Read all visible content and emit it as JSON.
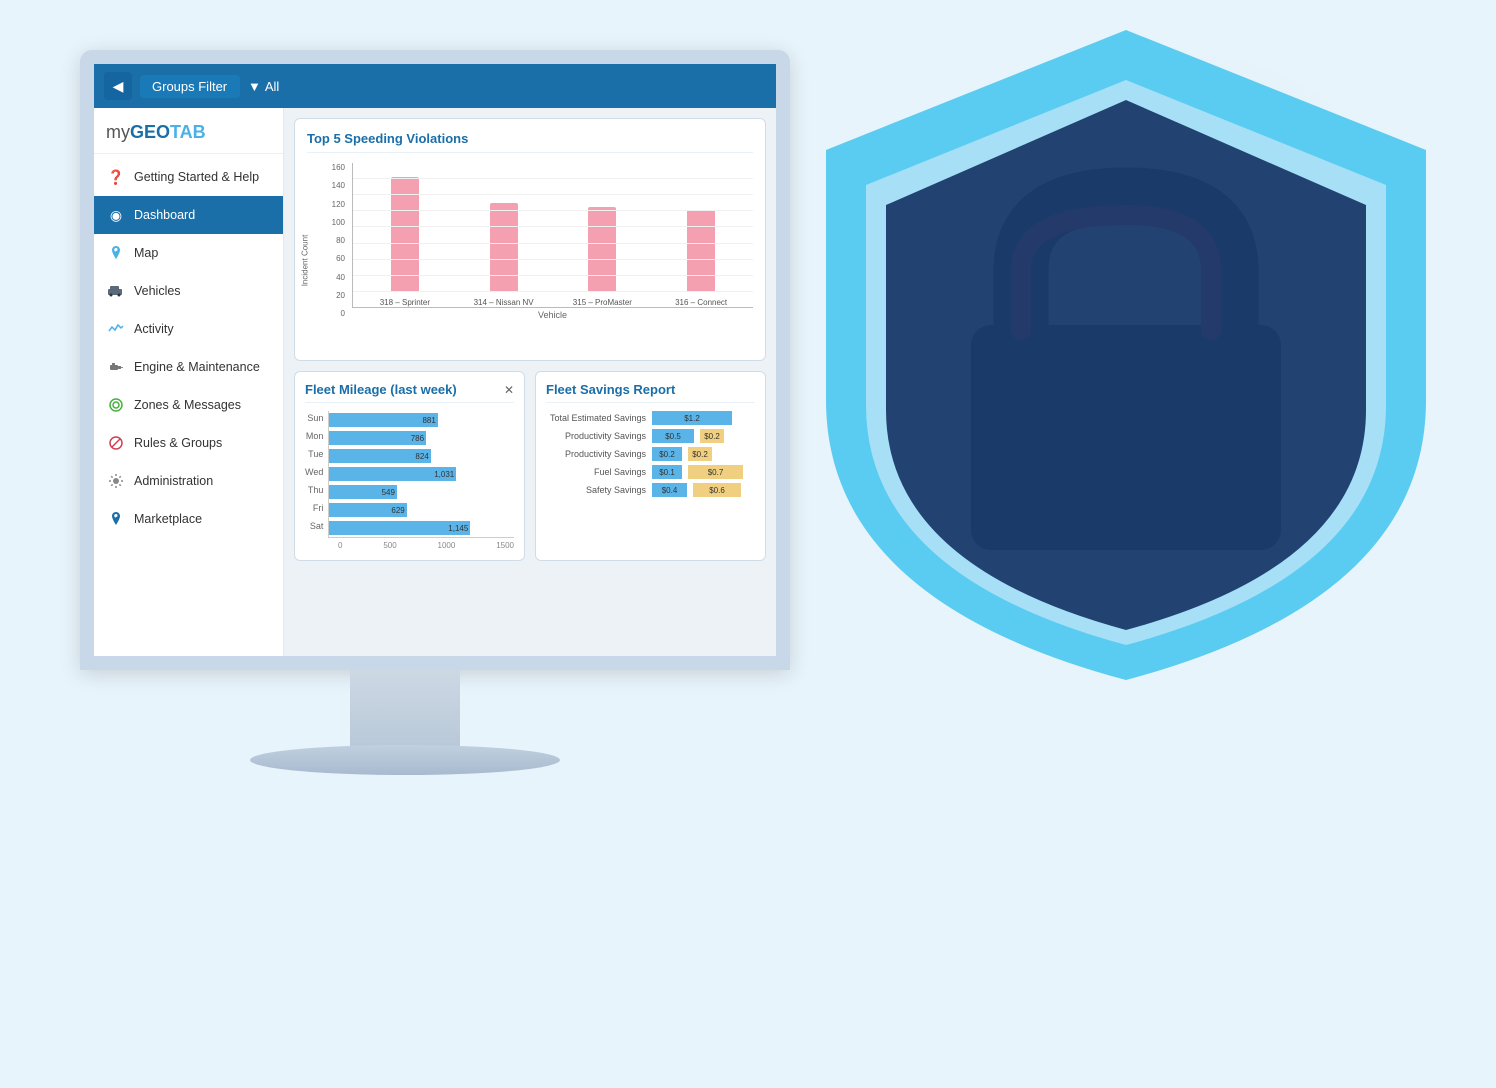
{
  "topbar": {
    "back_icon": "◀",
    "filter_label": "Groups Filter",
    "all_label": "All",
    "dropdown_icon": "▼"
  },
  "logo": {
    "my": "my",
    "geo": "GEO",
    "tab": "TAB"
  },
  "sidebar": {
    "items": [
      {
        "id": "getting-started",
        "label": "Getting Started & Help",
        "icon": "❓",
        "active": false
      },
      {
        "id": "dashboard",
        "label": "Dashboard",
        "icon": "◉",
        "active": true
      },
      {
        "id": "map",
        "label": "Map",
        "icon": "📍",
        "active": false
      },
      {
        "id": "vehicles",
        "label": "Vehicles",
        "icon": "🚛",
        "active": false
      },
      {
        "id": "activity",
        "label": "Activity",
        "icon": "📈",
        "active": false
      },
      {
        "id": "engine-maintenance",
        "label": "Engine & Maintenance",
        "icon": "🔧",
        "active": false
      },
      {
        "id": "zones-messages",
        "label": "Zones & Messages",
        "icon": "⚙",
        "active": false
      },
      {
        "id": "rules-groups",
        "label": "Rules & Groups",
        "icon": "🚫",
        "active": false
      },
      {
        "id": "administration",
        "label": "Administration",
        "icon": "⚙",
        "active": false
      },
      {
        "id": "marketplace",
        "label": "Marketplace",
        "icon": "📍",
        "active": false
      }
    ]
  },
  "top_chart": {
    "title": "Top 5 Speeding Violations",
    "y_axis_label": "Incident Count",
    "x_axis_label": "Vehicle",
    "y_labels": [
      "160",
      "140",
      "120",
      "100",
      "80",
      "60",
      "40",
      "20",
      "0"
    ],
    "bars": [
      {
        "label": "318 – Sprinter",
        "value": 140,
        "max": 160
      },
      {
        "label": "314 – Nissan NV",
        "value": 108,
        "max": 160
      },
      {
        "label": "315 – ProMaster",
        "value": 104,
        "max": 160
      },
      {
        "label": "316 – Connect",
        "value": 100,
        "max": 160
      }
    ]
  },
  "mileage_chart": {
    "title": "Fleet Mileage (last week)",
    "close_icon": "✕",
    "rows": [
      {
        "day": "Sun",
        "value": 881,
        "max": 1500
      },
      {
        "day": "Mon",
        "value": 786,
        "max": 1500
      },
      {
        "day": "Tue",
        "value": 824,
        "max": 1500
      },
      {
        "day": "Wed",
        "value": 1031,
        "max": 1500
      },
      {
        "day": "Thu",
        "value": 549,
        "max": 1500
      },
      {
        "day": "Fri",
        "value": 629,
        "max": 1500
      },
      {
        "day": "Sat",
        "value": 1145,
        "max": 1500
      }
    ],
    "x_labels": [
      "0",
      "500",
      "1000",
      "1500"
    ]
  },
  "savings_chart": {
    "title": "Fleet Savings Report",
    "rows": [
      {
        "label": "Total Estimated Savings",
        "blue_val": "$1.2",
        "blue_w": 80,
        "yellow_val": null,
        "yellow_w": 0
      },
      {
        "label": "Productivity Savings",
        "blue_val": "$0.5",
        "blue_w": 42,
        "yellow_val": "$0.2",
        "yellow_w": 18
      },
      {
        "label": "Productivity Savings",
        "blue_val": "$0.2",
        "blue_w": 18,
        "yellow_val": "$0.2",
        "yellow_w": 18
      },
      {
        "label": "Fuel Savings",
        "blue_val": "$0.1",
        "blue_w": 10,
        "yellow_val": "$0.7",
        "yellow_w": 55
      },
      {
        "label": "Safety Savings",
        "blue_val": "$0.4",
        "blue_w": 35,
        "yellow_val": "$0.6",
        "yellow_w": 48
      }
    ]
  }
}
